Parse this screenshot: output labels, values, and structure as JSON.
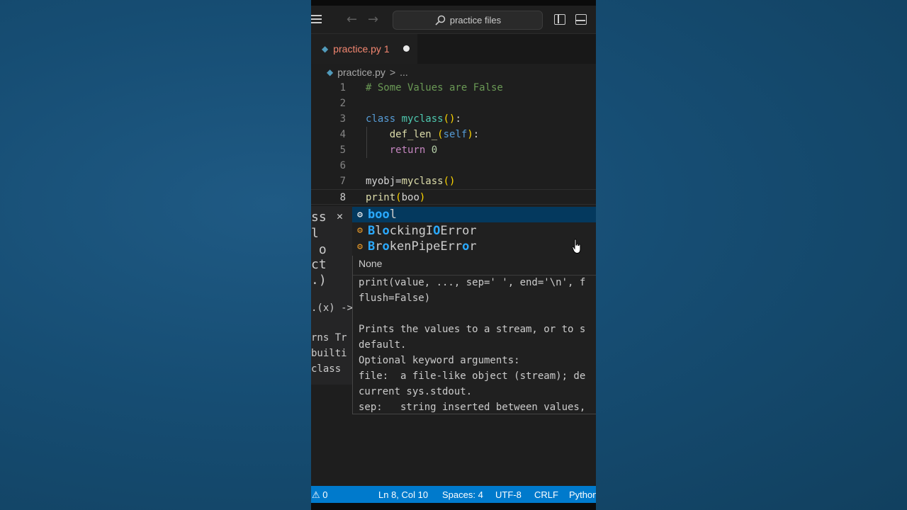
{
  "search": {
    "text": "practice files",
    "icon": "search-icon"
  },
  "tab": {
    "filename": "practice.py",
    "problems": "1"
  },
  "breadcrumb": {
    "file": "practice.py",
    "sep": ">",
    "more": "..."
  },
  "code_lines": [
    {
      "num": "1",
      "tokens": [
        {
          "t": "# Some Values are False",
          "c": "cm"
        }
      ]
    },
    {
      "num": "2",
      "tokens": []
    },
    {
      "num": "3",
      "tokens": [
        {
          "t": "class ",
          "c": "kw"
        },
        {
          "t": "myclass",
          "c": "cls"
        },
        {
          "t": "()",
          "c": "br"
        },
        {
          "t": ":",
          "c": "plain"
        }
      ]
    },
    {
      "num": "4",
      "tokens": [
        {
          "t": "    def_len_",
          "c": "fn"
        },
        {
          "t": "(",
          "c": "br"
        },
        {
          "t": "self",
          "c": "self"
        },
        {
          "t": ")",
          "c": "br"
        },
        {
          "t": ":",
          "c": "plain"
        }
      ]
    },
    {
      "num": "5",
      "tokens": [
        {
          "t": "    return ",
          "c": "ctrl"
        },
        {
          "t": "0",
          "c": "num"
        }
      ]
    },
    {
      "num": "6",
      "tokens": []
    },
    {
      "num": "7",
      "tokens": [
        {
          "t": "myobj",
          "c": "plain"
        },
        {
          "t": "=",
          "c": "plain"
        },
        {
          "t": "myclass",
          "c": "fn"
        },
        {
          "t": "()",
          "c": "br"
        }
      ]
    },
    {
      "num": "8",
      "tokens": [
        {
          "t": "print",
          "c": "fn"
        },
        {
          "t": "(",
          "c": "br"
        },
        {
          "t": "boo",
          "c": "plain"
        },
        {
          "t": ")",
          "c": "br"
        }
      ]
    }
  ],
  "left_panel": {
    "lines": [
      "ss",
      "l",
      " o",
      "ct",
      ".)",
      "",
      ".(x) ->",
      "",
      "rns Tr",
      "builti",
      "class"
    ]
  },
  "suggestions": [
    {
      "parts": [
        {
          "t": "boo",
          "m": true
        },
        {
          "t": "l",
          "m": false
        }
      ],
      "selected": true
    },
    {
      "parts": [
        {
          "t": "B",
          "m": true
        },
        {
          "t": "l",
          "m": false
        },
        {
          "t": "o",
          "m": true
        },
        {
          "t": "ckingI",
          "m": false
        },
        {
          "t": "O",
          "m": true
        },
        {
          "t": "Error",
          "m": false
        }
      ],
      "selected": false
    },
    {
      "parts": [
        {
          "t": "B",
          "m": true
        },
        {
          "t": "r",
          "m": false
        },
        {
          "t": "o",
          "m": true
        },
        {
          "t": "kenPipeErr",
          "m": false
        },
        {
          "t": "o",
          "m": true
        },
        {
          "t": "r",
          "m": false
        }
      ],
      "selected": false
    }
  ],
  "detail": {
    "header": "None",
    "lines": [
      "print(value, ..., sep=' ', end='\\n', f",
      "flush=False)",
      "",
      "Prints the values to a stream, or to s",
      "default.",
      "Optional keyword arguments:",
      "file:  a file-like object (stream); de",
      "current sys.stdout.",
      "sep:   string inserted between values,"
    ]
  },
  "status": {
    "problems": "0",
    "position": "Ln 8, Col 10",
    "spaces": "Spaces: 4",
    "encoding": "UTF-8",
    "eol": "CRLF",
    "language": "Python"
  }
}
